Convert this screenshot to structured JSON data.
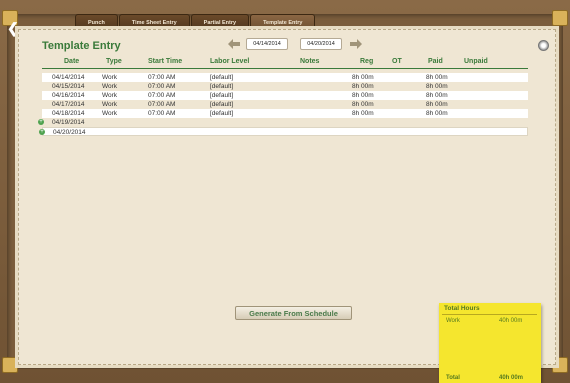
{
  "tabs": [
    {
      "label": "Punch",
      "active": false
    },
    {
      "label": "Time Sheet Entry",
      "active": false
    },
    {
      "label": "Partial Entry",
      "active": false
    },
    {
      "label": "Template Entry",
      "active": true
    }
  ],
  "page_title": "Template Entry",
  "date_range": {
    "start": "04/14/2014",
    "end": "04/20/2014"
  },
  "columns": {
    "date": "Date",
    "type": "Type",
    "start_time": "Start Time",
    "labor_level": "Labor Level",
    "notes": "Notes",
    "reg": "Reg",
    "ot": "OT",
    "paid": "Paid",
    "unpaid": "Unpaid"
  },
  "rows": [
    {
      "date": "04/14/2014",
      "type": "Work",
      "start_time": "07:00 AM",
      "labor_level": "[default]",
      "reg": "8h 00m",
      "paid": "8h 00m"
    },
    {
      "date": "04/15/2014",
      "type": "Work",
      "start_time": "07:00 AM",
      "labor_level": "[default]",
      "reg": "8h 00m",
      "paid": "8h 00m"
    },
    {
      "date": "04/16/2014",
      "type": "Work",
      "start_time": "07:00 AM",
      "labor_level": "[default]",
      "reg": "8h 00m",
      "paid": "8h 00m"
    },
    {
      "date": "04/17/2014",
      "type": "Work",
      "start_time": "07:00 AM",
      "labor_level": "[default]",
      "reg": "8h 00m",
      "paid": "8h 00m"
    },
    {
      "date": "04/18/2014",
      "type": "Work",
      "start_time": "07:00 AM",
      "labor_level": "[default]",
      "reg": "8h 00m",
      "paid": "8h 00m"
    }
  ],
  "empty_days": [
    "04/19/2014",
    "04/20/2014"
  ],
  "generate_label": "Generate From Schedule",
  "totals": {
    "title": "Total Hours",
    "work_label": "Work",
    "work_value": "40h 00m",
    "total_label": "Total",
    "total_value": "40h 00m"
  },
  "colors": {
    "accent": "#3a7a3a",
    "sticky": "#f5e62e"
  }
}
